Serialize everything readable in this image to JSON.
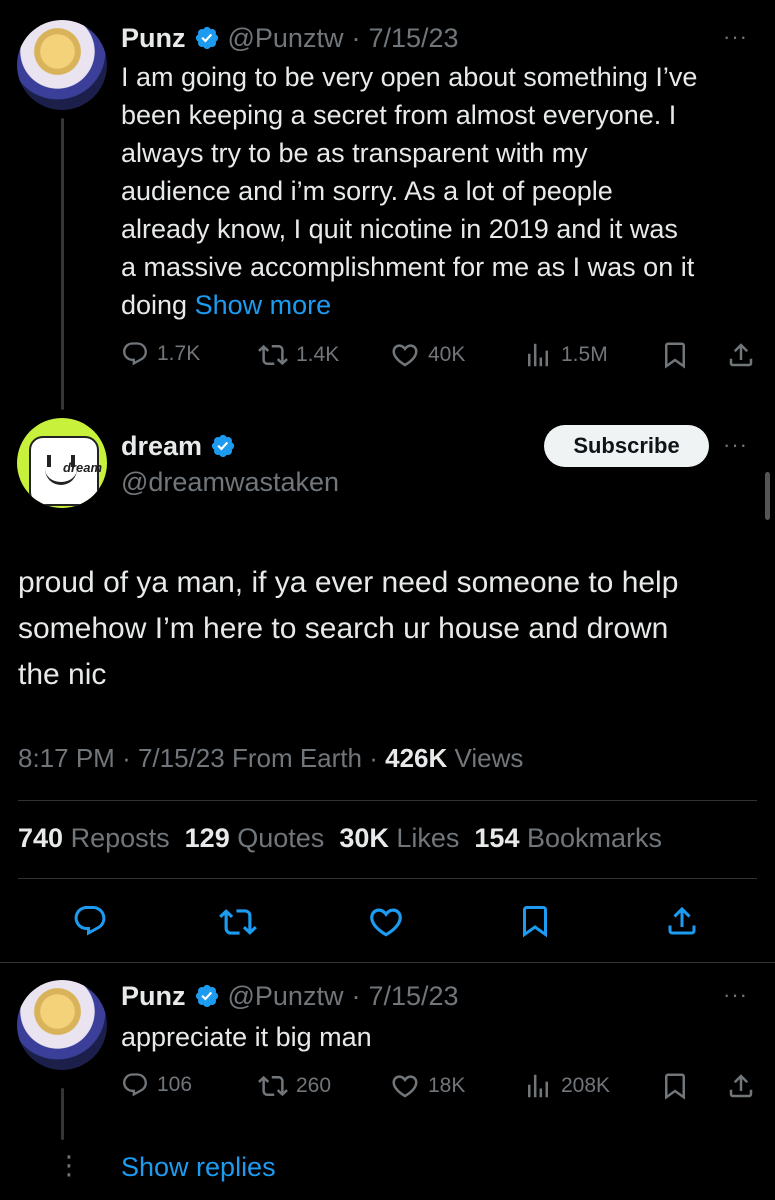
{
  "tweet1": {
    "name": "Punz",
    "handle": "@Punztw",
    "sep": "·",
    "date": "7/15/23",
    "more": "···",
    "lines": [
      "I am going to be very open about something I’ve",
      "been keeping a secret from almost everyone. I",
      "always try to be as transparent with my",
      "audience and i’m sorry. As a lot of people",
      "already know, I quit nicotine in 2019 and it was",
      "a massive accomplishment for me as I was on it"
    ],
    "last_line": "doing",
    "show_more": "Show more",
    "replies": "1.7K",
    "reposts": "1.4K",
    "likes": "40K",
    "views": "1.5M"
  },
  "main": {
    "name": "dream",
    "handle": "@dreamwastaken",
    "avatar_text": "dream",
    "subscribe": "Subscribe",
    "more": "···",
    "lines": [
      "proud of ya man, if ya ever need someone to help",
      "somehow I’m here to search ur house and drown",
      "the nic"
    ],
    "time": "8:17 PM",
    "sep": "·",
    "date": "7/15/23",
    "source": "From Earth",
    "views_num": "426K",
    "views_label": "Views",
    "stats": {
      "reposts_num": "740",
      "reposts_label": "Reposts",
      "quotes_num": "129",
      "quotes_label": "Quotes",
      "likes_num": "30K",
      "likes_label": "Likes",
      "bookmarks_num": "154",
      "bookmarks_label": "Bookmarks"
    }
  },
  "reply": {
    "name": "Punz",
    "handle": "@Punztw",
    "sep": "·",
    "date": "7/15/23",
    "more": "···",
    "text": "appreciate it big man",
    "replies": "106",
    "reposts": "260",
    "likes": "18K",
    "views": "208K",
    "show_replies": "Show replies",
    "thread_dots": "⋮"
  },
  "colors": {
    "background": "#000000",
    "text": "#e7e9ea",
    "muted": "#71767b",
    "accent": "#1d9bf0",
    "divider": "#2f3336",
    "dream_green": "#c8f13c"
  },
  "icons": [
    "verified-badge-icon",
    "reply-icon",
    "repost-icon",
    "like-icon",
    "views-icon",
    "bookmark-icon",
    "share-icon"
  ]
}
